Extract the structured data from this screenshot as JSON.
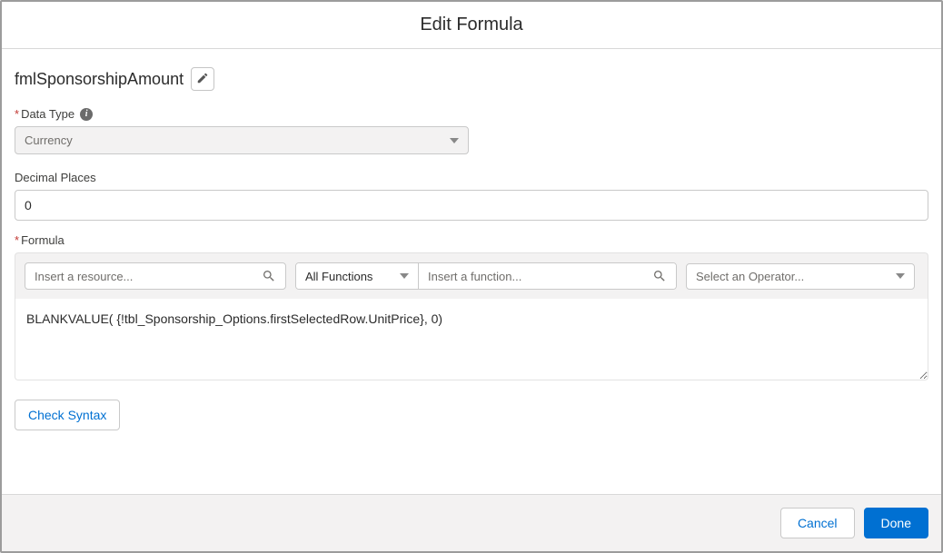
{
  "modal": {
    "title": "Edit Formula"
  },
  "apiName": "fmlSponsorshipAmount",
  "labels": {
    "dataType": "Data Type",
    "decimalPlaces": "Decimal Places",
    "formula": "Formula",
    "allFunctions": "All Functions",
    "checkSyntax": "Check Syntax"
  },
  "placeholders": {
    "resource": "Insert a resource...",
    "function": "Insert a function...",
    "operator": "Select an Operator..."
  },
  "values": {
    "dataType": "Currency",
    "decimalPlaces": "0",
    "formulaBody": "BLANKVALUE( {!tbl_Sponsorship_Options.firstSelectedRow.UnitPrice}, 0)"
  },
  "footer": {
    "cancel": "Cancel",
    "done": "Done"
  }
}
